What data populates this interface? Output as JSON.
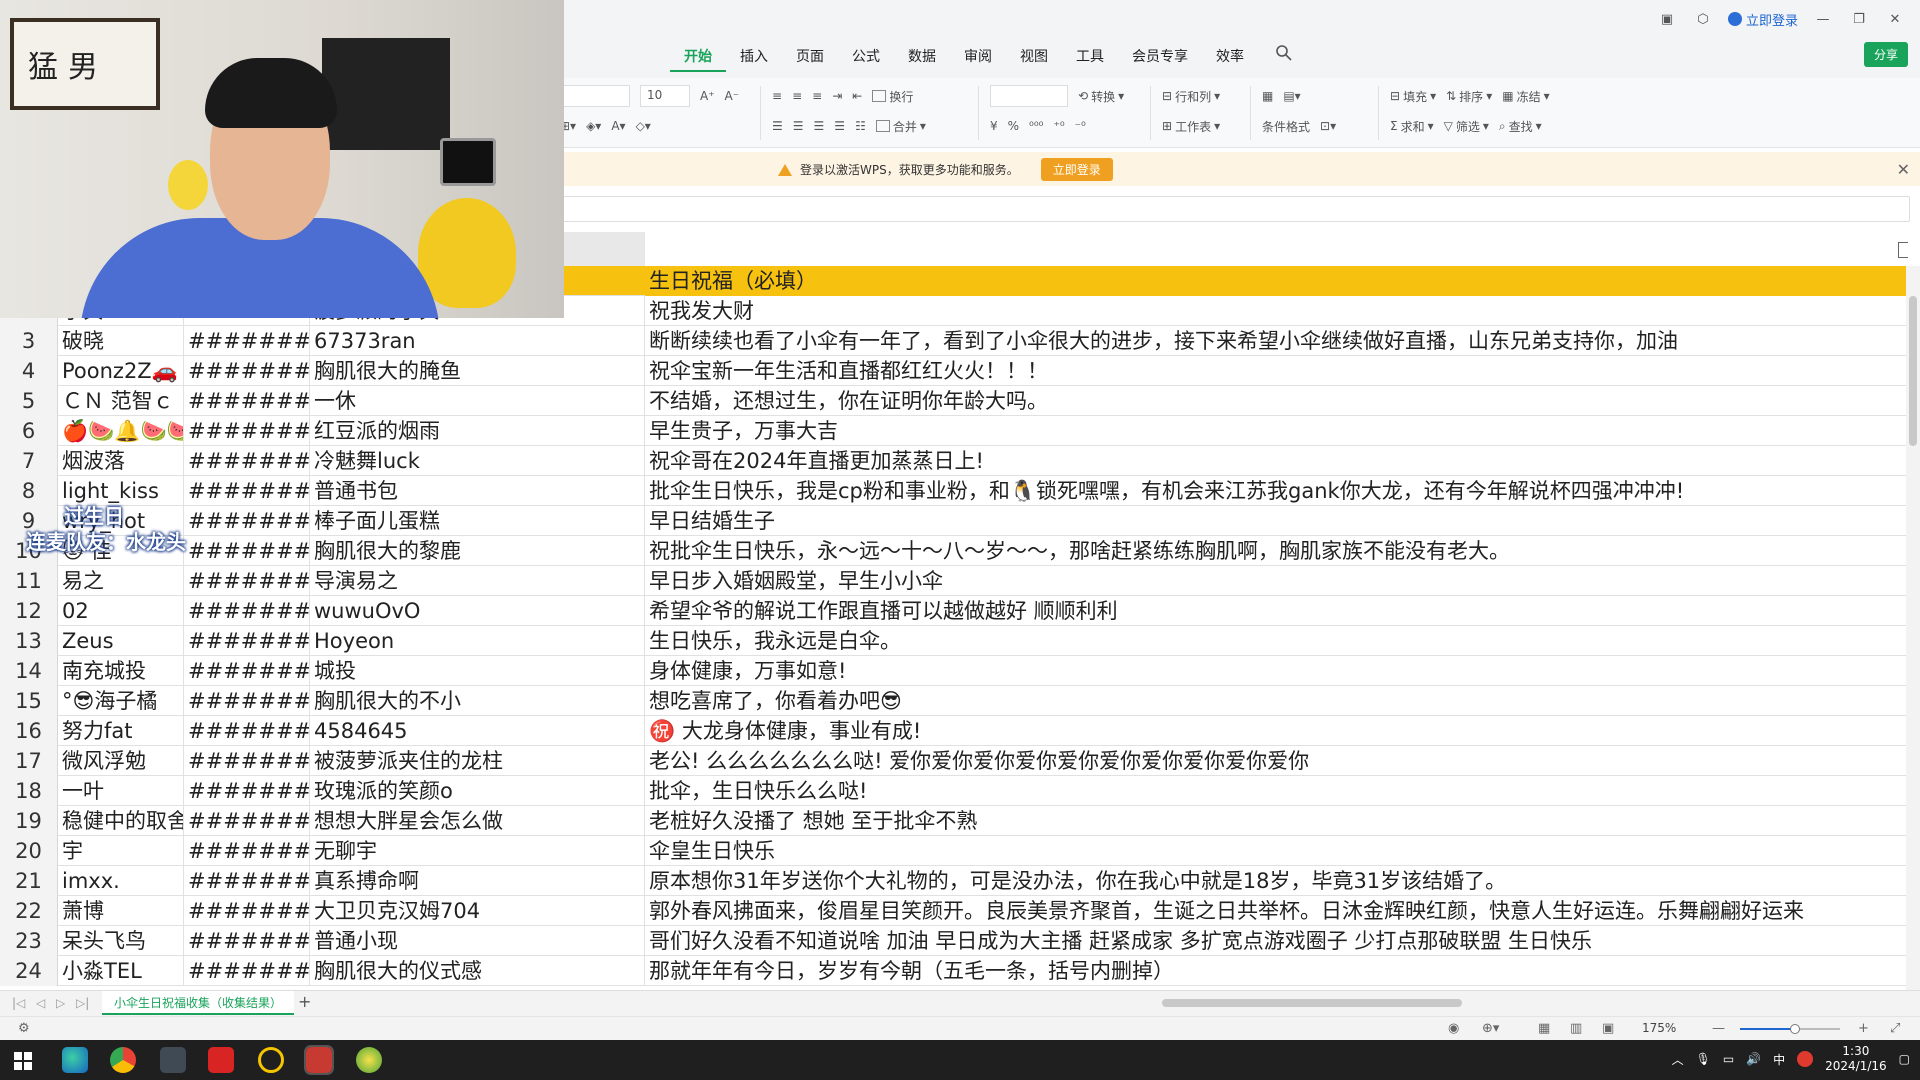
{
  "ribbon": {
    "tabs": [
      {
        "label": "开始",
        "active": true
      },
      {
        "label": "插入"
      },
      {
        "label": "页面"
      },
      {
        "label": "公式"
      },
      {
        "label": "数据"
      },
      {
        "label": "审阅"
      },
      {
        "label": "视图"
      },
      {
        "label": "工具"
      },
      {
        "label": "会员专享"
      },
      {
        "label": "效率"
      }
    ],
    "login_label": "立即登录",
    "share_label": "分享"
  },
  "toolbar": {
    "font_size": "10",
    "wrap": "换行",
    "merge": "合并",
    "convert": "转换",
    "row_col": "行和列",
    "worksheet": "工作表",
    "cond_format": "条件格式",
    "fill": "填充",
    "sort": "排序",
    "freeze": "冻结",
    "sum": "求和",
    "filter": "筛选",
    "find": "查找",
    "currency": "¥",
    "percent": "%"
  },
  "notice": {
    "text": "登录以激活WPS，获取更多功能和服务。",
    "button": "立即登录"
  },
  "sheet": {
    "header_wish": "生日祝福（必填）",
    "rows": [
      {
        "num": "2",
        "name": "小贝",
        "date": "#########",
        "nick": "菠萝派的小贝",
        "wish": "祝我发大财"
      },
      {
        "num": "3",
        "name": "破晓",
        "date": "#########",
        "nick": "67373ran",
        "wish": "断断续续也看了小伞有一年了，看到了小伞很大的进步，接下来希望小伞继续做好直播，山东兄弟支持你，加油"
      },
      {
        "num": "4",
        "name": "Poonz2Z🚗",
        "date": "#########",
        "nick": "胸肌很大的腌鱼",
        "wish": "祝伞宝新一年生活和直播都红红火火！！！"
      },
      {
        "num": "5",
        "name": "ＣＮ 范智ｃ",
        "date": "#########",
        "nick": "一休",
        "wish": "不结婚，还想过生，你在证明你年龄大吗。"
      },
      {
        "num": "6",
        "name": "🍎🍉🔔🍉🍉",
        "date": "#########",
        "nick": "红豆派的烟雨",
        "wish": "早生贵子，万事大吉"
      },
      {
        "num": "7",
        "name": "烟波落",
        "date": "#########",
        "nick": "冷魅舞luck",
        "wish": "祝伞哥在2024年直播更加蒸蒸日上!"
      },
      {
        "num": "8",
        "name": "light_kiss",
        "date": "#########",
        "nick": "普通书包",
        "wish": "批伞生日快乐，我是cp粉和事业粉，和🐧锁死嘿嘿，有机会来江苏我gank你大龙，还有今年解说杯四强冲冲冲!"
      },
      {
        "num": "9",
        "name": "wry_hot",
        "date": "#########",
        "nick": "棒子面儿蛋糕",
        "wish": "早日结婚生子"
      },
      {
        "num": "10",
        "name": "🐱 佳",
        "date": "#########",
        "nick": "胸肌很大的黎鹿",
        "wish": "祝批伞生日快乐，永～远～十～八～岁～～，那啥赶紧练练胸肌啊，胸肌家族不能没有老大。"
      },
      {
        "num": "11",
        "name": "易之",
        "date": "#########",
        "nick": "导演易之",
        "wish": "早日步入婚姻殿堂，早生小小伞"
      },
      {
        "num": "12",
        "name": "02",
        "date": "#########",
        "nick": "wuwuOvO",
        "wish": "希望伞爷的解说工作跟直播可以越做越好 顺顺利利"
      },
      {
        "num": "13",
        "name": "Zeus",
        "date": "#########",
        "nick": "Hoyeon",
        "wish": "生日快乐，我永远是白伞。"
      },
      {
        "num": "14",
        "name": "南充城投",
        "date": "#########",
        "nick": "城投",
        "wish": "身体健康，万事如意!"
      },
      {
        "num": "15",
        "name": "°😎海子橘",
        "date": "#########",
        "nick": "胸肌很大的不小",
        "wish": "想吃喜席了，你看着办吧😎"
      },
      {
        "num": "16",
        "name": "努力fat",
        "date": "#########",
        "nick": "4584645",
        "wish": "㊗️ 大龙身体健康，事业有成!"
      },
      {
        "num": "17",
        "name": "微风浮勉",
        "date": "#########",
        "nick": "被菠萝派夹住的龙柱",
        "wish": "老公! 么么么么么么么哒! 爱你爱你爱你爱你爱你爱你爱你爱你爱你爱你"
      },
      {
        "num": "18",
        "name": "一叶",
        "date": "#########",
        "nick": "玫瑰派的笑颜o",
        "wish": "批伞，生日快乐么么哒!"
      },
      {
        "num": "19",
        "name": "稳健中的取舍",
        "date": "#########",
        "nick": "想想大胖星会怎么做",
        "wish": "老桩好久没播了 想她 至于批伞不熟"
      },
      {
        "num": "20",
        "name": "宇",
        "date": "#########",
        "nick": "无聊宇",
        "wish": "伞皇生日快乐"
      },
      {
        "num": "21",
        "name": "imxx.",
        "date": "#########",
        "nick": "真系搏命啊",
        "wish": "原本想你31年岁送你个大礼物的，可是没办法，你在我心中就是18岁，毕竟31岁该结婚了。"
      },
      {
        "num": "22",
        "name": "萧博",
        "date": "#########",
        "nick": "大卫贝克汉姆704",
        "wish": "郭外春风拂面来，俊眉星目笑颜开。良辰美景齐聚首，生诞之日共举杯。日沐金辉映红颜，快意人生好运连。乐舞翩翩好运来"
      },
      {
        "num": "23",
        "name": "呆头飞鸟",
        "date": "#########",
        "nick": "普通小现",
        "wish": "哥们好久没看不知道说啥 加油 早日成为大主播 赶紧成家 多扩宽点游戏圈子 少打点那破联盟 生日快乐"
      },
      {
        "num": "24",
        "name": "小淼TEL",
        "date": "#########",
        "nick": "胸肌很大的仪式感",
        "wish": "那就年年有今日，岁岁有今朝（五毛一条，括号内删掉）"
      }
    ]
  },
  "sheet_tab": "小伞生日祝福收集（收集结果）",
  "status": {
    "zoom": "175%",
    "zoom_fraction": 0.55
  },
  "webcam": {
    "frame_text": "猛男",
    "caption_line1": "过生日",
    "caption_line2": "连麦队友：水龙头"
  },
  "taskbar": {
    "ime": "中",
    "time": "1:30",
    "date": "2024/1/16"
  },
  "colors": {
    "accent": "#1aa35a",
    "header_fill": "#f6c20f",
    "notice_bg": "#fdf4e3",
    "taskbar": "#1f1f1f"
  }
}
